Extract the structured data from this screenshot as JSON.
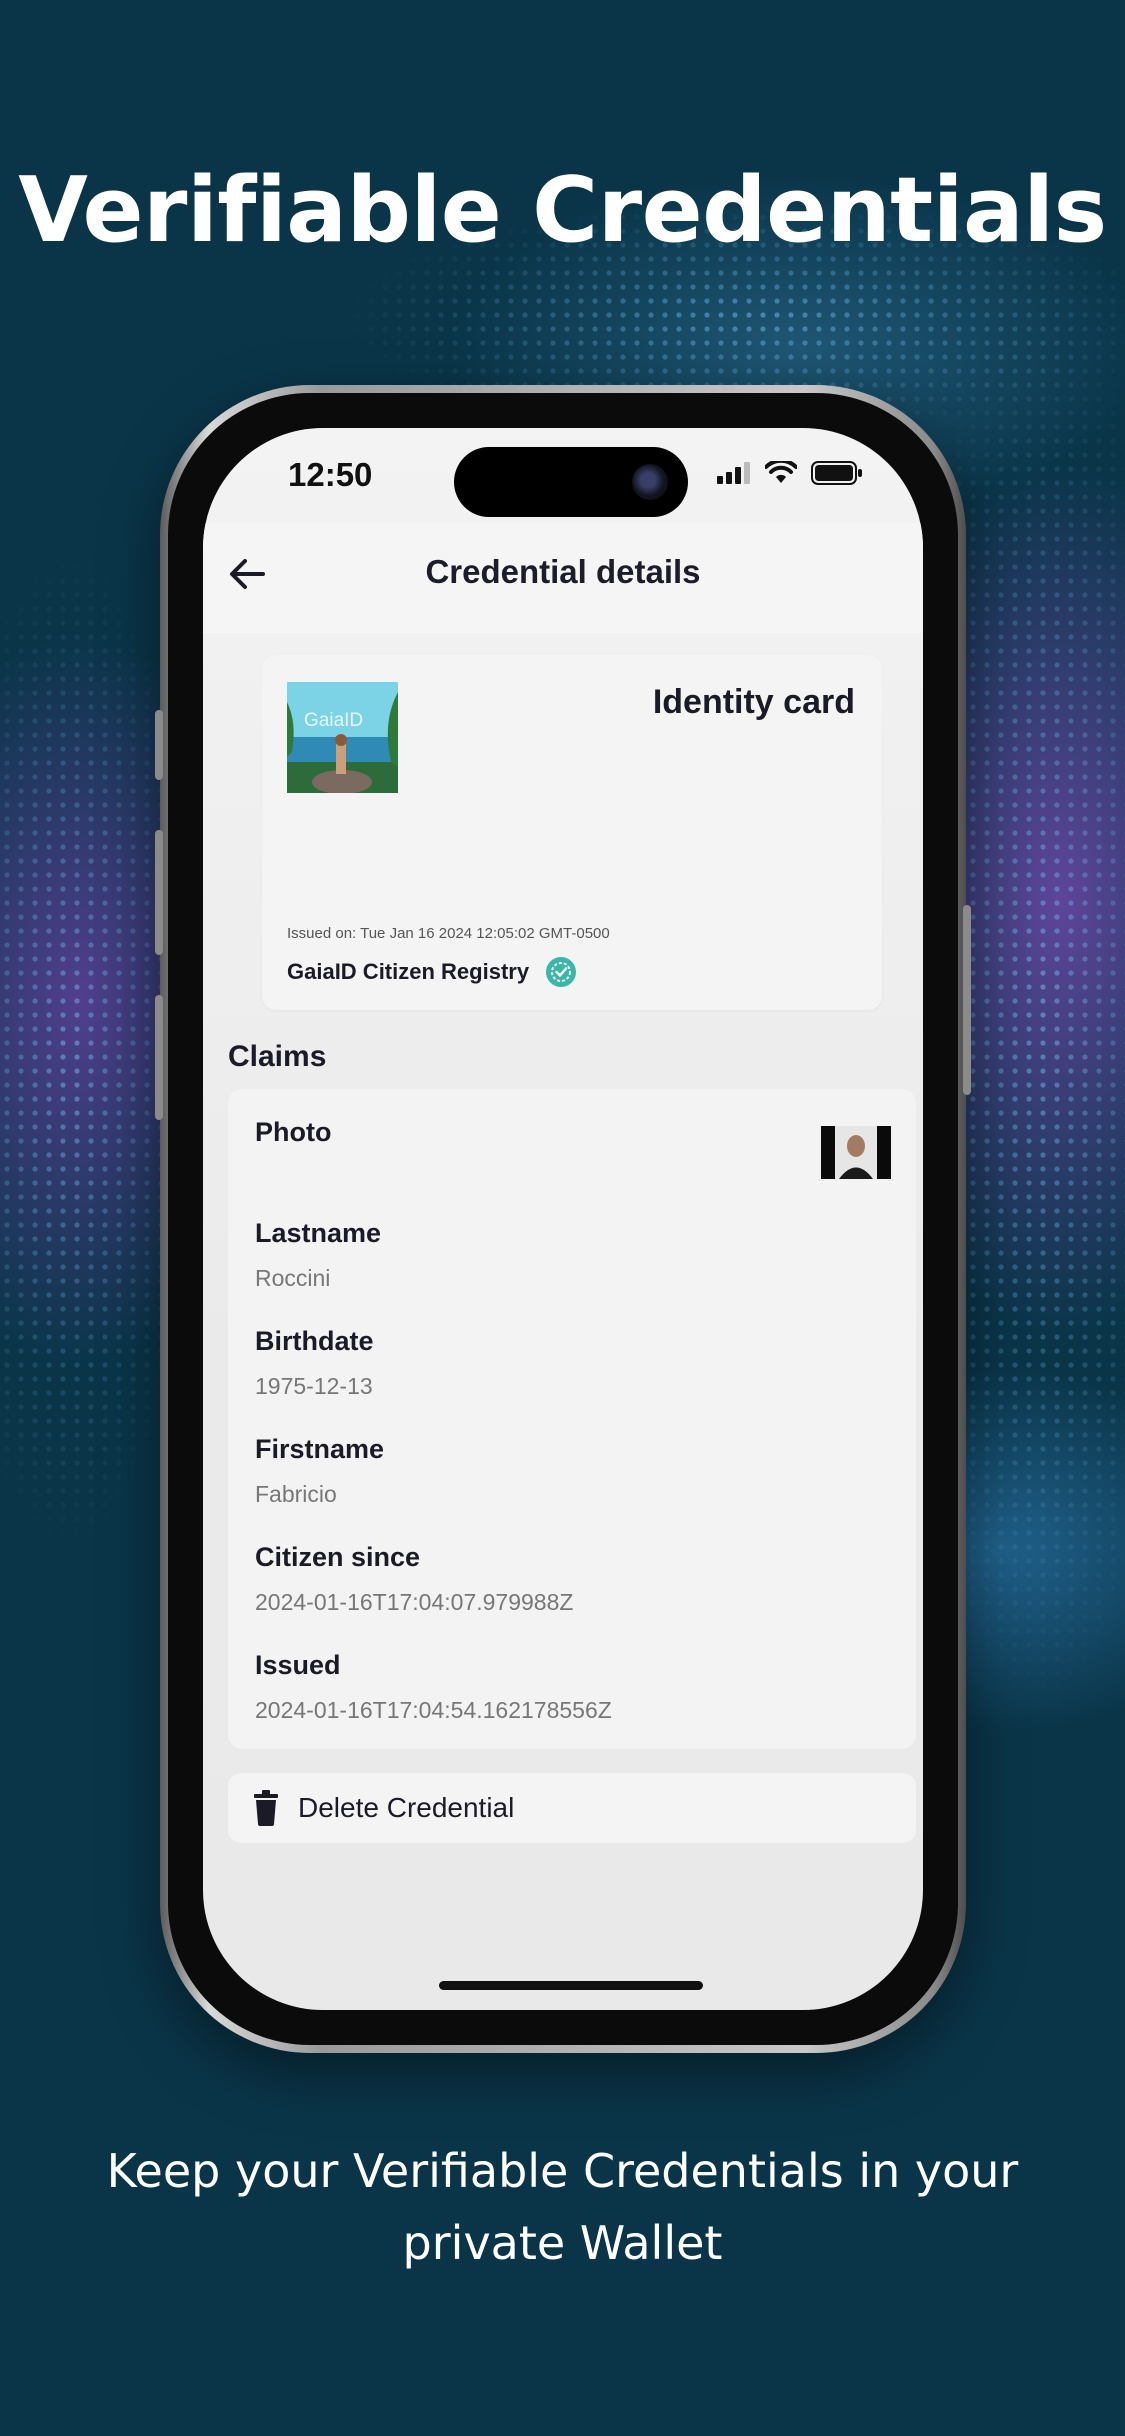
{
  "promo": {
    "headline": "Verifiable Credentials",
    "tagline": "Keep your Verifiable Credentials in your private Wallet"
  },
  "status_bar": {
    "time": "12:50",
    "icons": [
      "signal-icon",
      "wifi-icon",
      "battery-icon"
    ]
  },
  "header": {
    "back_icon": "arrow-left-icon",
    "title": "Credential details"
  },
  "credential_card": {
    "title": "Identity card",
    "logo_text": "GaiaID",
    "issued_on": "Issued on: Tue Jan 16 2024 12:05:02 GMT-0500",
    "issuer": "GaiaID Citizen Registry",
    "verified_icon": "verified-check-icon"
  },
  "claims": {
    "heading": "Claims",
    "items": [
      {
        "label": "Photo",
        "value": ""
      },
      {
        "label": "Lastname",
        "value": "Roccini"
      },
      {
        "label": "Birthdate",
        "value": "1975-12-13"
      },
      {
        "label": "Firstname",
        "value": "Fabricio"
      },
      {
        "label": "Citizen since",
        "value": "2024-01-16T17:04:07.979988Z"
      },
      {
        "label": "Issued",
        "value": "2024-01-16T17:04:54.162178556Z"
      }
    ]
  },
  "actions": {
    "delete_label": "Delete Credential",
    "delete_icon": "trash-icon"
  },
  "colors": {
    "background": "#0a3549",
    "verified_badge": "#3bb6a8",
    "text_dark": "#1b1b28"
  }
}
